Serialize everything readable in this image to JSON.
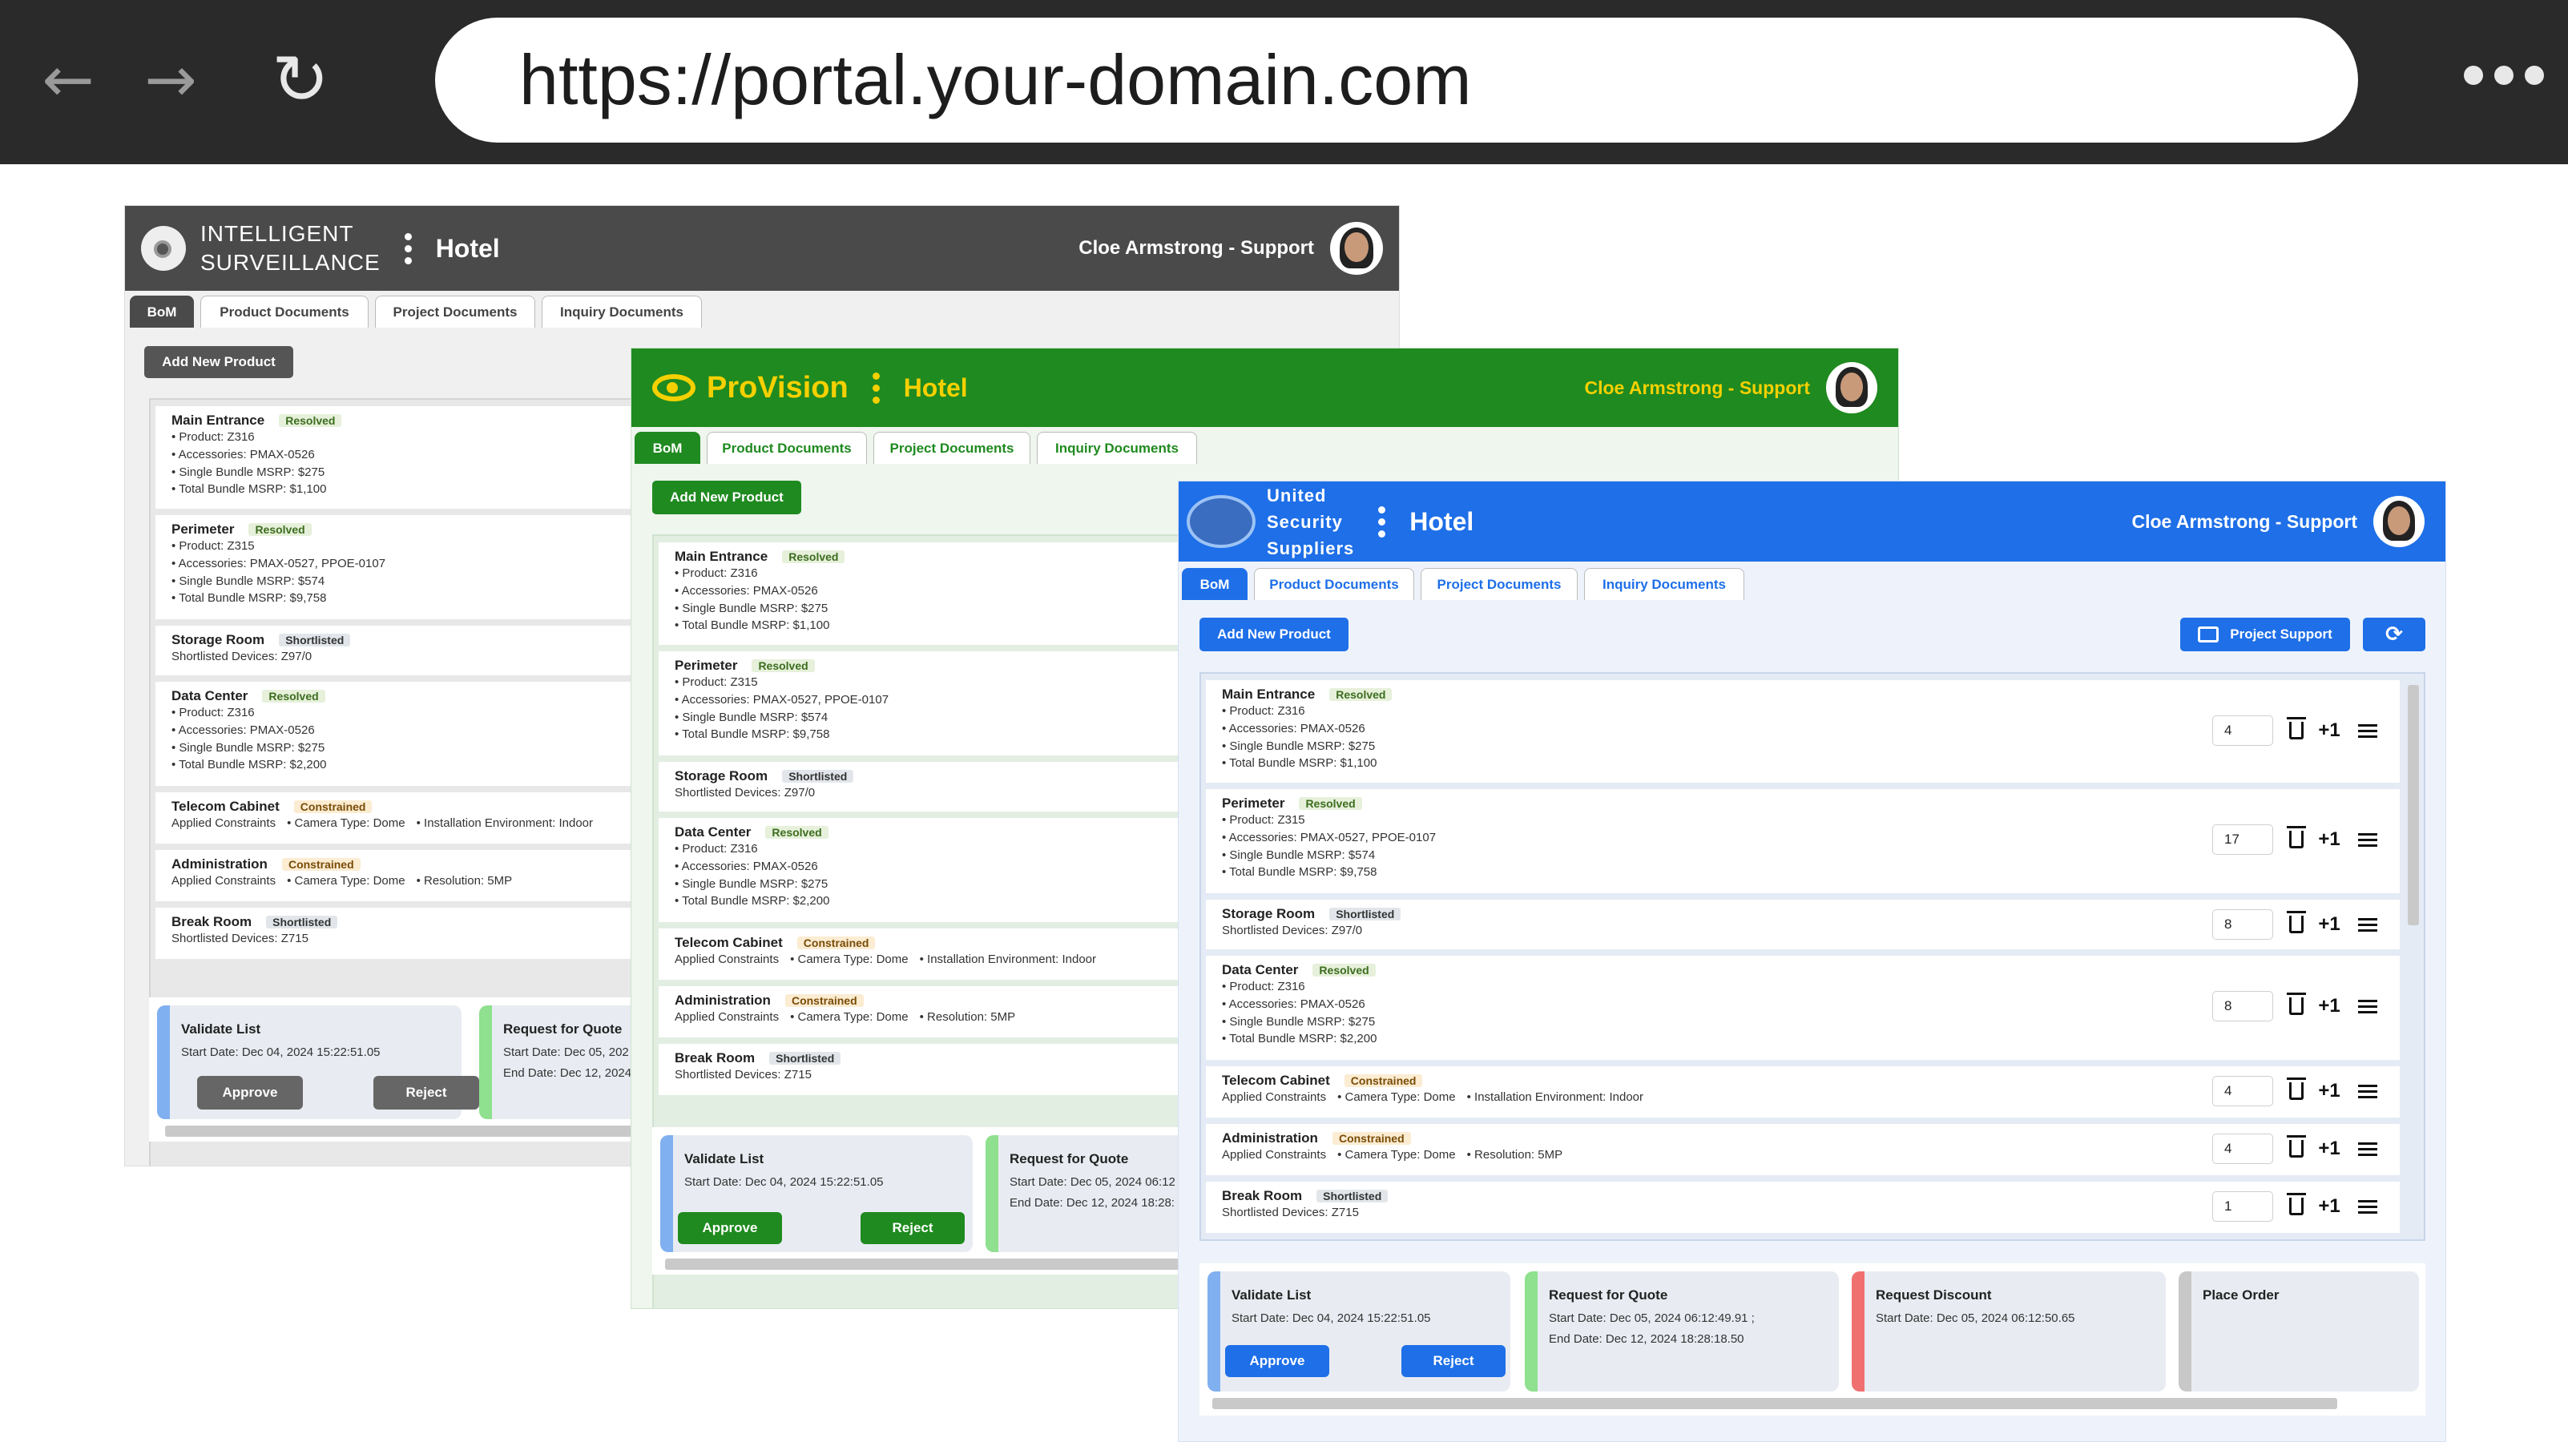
{
  "browser": {
    "url": "https://portal.your-domain.com",
    "back_icon": "arrow-left-icon",
    "forward_icon": "arrow-right-icon",
    "reload_icon": "reload-icon",
    "menu_icon": "more-horizontal-icon"
  },
  "windows": {
    "gray": {
      "brand_line1": "INTELLIGENT",
      "brand_line2": "SURVEILLANCE",
      "accent": "#4a4a4a"
    },
    "green": {
      "brand": "ProVision",
      "accent": "#1f8a1f"
    },
    "blue": {
      "brand_line1": "United",
      "brand_line2": "Security",
      "brand_line3": "Suppliers",
      "accent": "#1e6fe8",
      "project_support_label": "Project Support"
    }
  },
  "page_title": "Hotel",
  "user_label": "Cloe Armstrong - Support",
  "tabs": [
    "BoM",
    "Product Documents",
    "Project Documents",
    "Inquiry Documents"
  ],
  "add_product_label": "Add New Product",
  "items": [
    {
      "title": "Main Entrance",
      "status": "Resolved",
      "lines": [
        "Product: Z316",
        "Accessories: PMAX-0526",
        "Single Bundle MSRP: $275",
        "Total Bundle MSRP: $1,100"
      ],
      "qty": "4"
    },
    {
      "title": "Perimeter",
      "status": "Resolved",
      "lines": [
        "Product: Z315",
        "Accessories: PMAX-0527, PPOE-0107",
        "Single Bundle MSRP: $574",
        "Total Bundle MSRP: $9,758"
      ],
      "qty": "17"
    },
    {
      "title": "Storage Room",
      "status": "Shortlisted",
      "plain": "Shortlisted Devices: Z97/0",
      "qty": "8"
    },
    {
      "title": "Data Center",
      "status": "Resolved",
      "lines": [
        "Product: Z316",
        "Accessories: PMAX-0526",
        "Single Bundle MSRP: $275",
        "Total Bundle MSRP: $2,200"
      ],
      "qty": "8"
    },
    {
      "title": "Telecom Cabinet",
      "status": "Constrained",
      "label": "Applied Constraints",
      "constraints": [
        "Camera Type: Dome",
        "Installation Environment: Indoor"
      ],
      "qty": "4"
    },
    {
      "title": "Administration",
      "status": "Constrained",
      "label": "Applied Constraints",
      "constraints": [
        "Camera Type: Dome",
        "Resolution: 5MP"
      ],
      "qty": "4"
    },
    {
      "title": "Break Room",
      "status": "Shortlisted",
      "plain": "Shortlisted Devices: Z715",
      "qty": "1"
    }
  ],
  "row_controls": {
    "plus_label": "+1",
    "delete_icon": "trash-icon",
    "menu_icon": "hamburger-icon"
  },
  "workflow": {
    "validate": {
      "title": "Validate List",
      "start": "Start Date: Dec 04, 2024 15:22:51.05",
      "approve": "Approve",
      "reject": "Reject"
    },
    "quote": {
      "title": "Request for Quote",
      "start": "Start Date: Dec 05, 2024 06:12:49.91 ;",
      "end": "End Date: Dec 12, 2024 18:28:18.50"
    },
    "discount": {
      "title": "Request Discount",
      "start": "Start Date: Dec 05, 2024 06:12:50.65"
    },
    "order": {
      "title": "Place Order"
    }
  },
  "cropped": {
    "quote_start_gray": "Start Date: Dec 05, 202",
    "quote_end_gray": "End Date: Dec 12, 2024",
    "quote_start_green": "Start Date: Dec 05, 2024 06:12",
    "quote_end_green": "End Date: Dec 12, 2024 18:28:"
  }
}
